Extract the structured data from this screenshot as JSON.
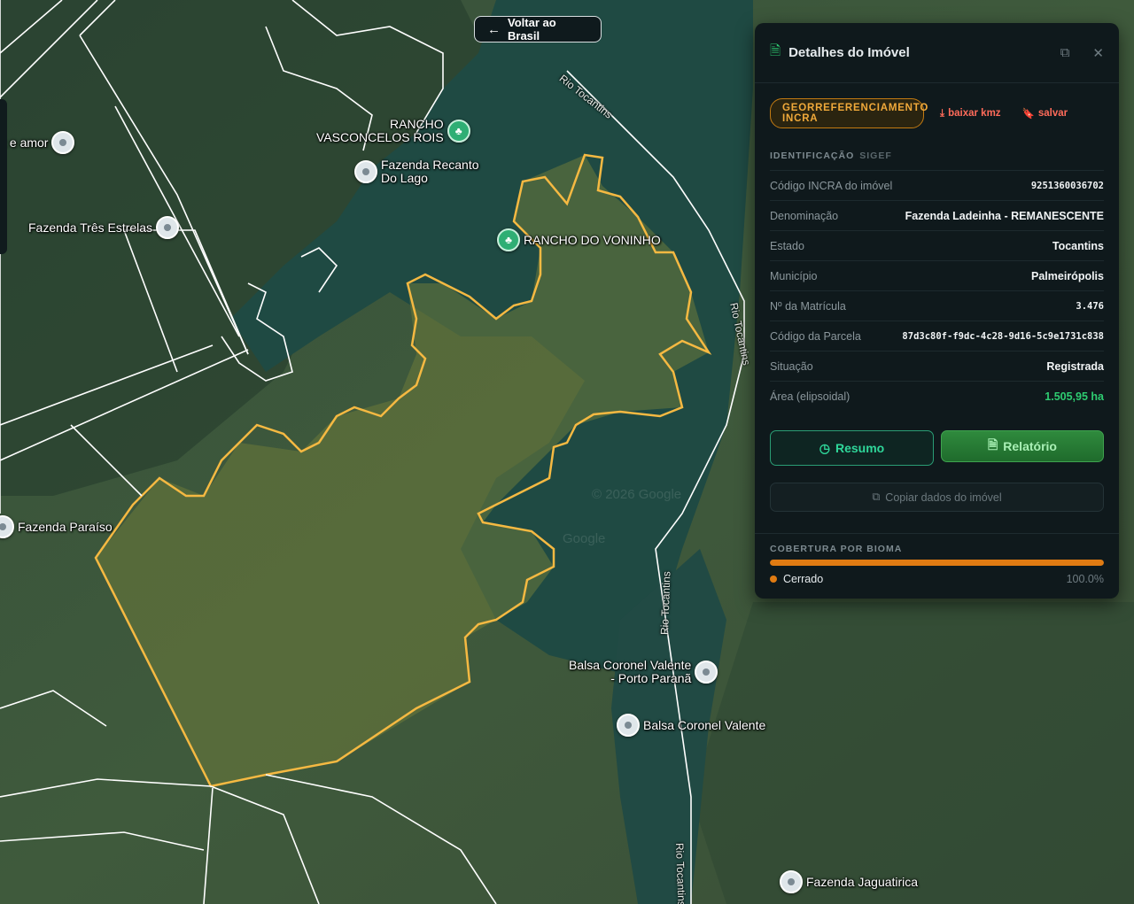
{
  "back_button": {
    "label": "Voltar ao Brasil",
    "icon": "arrow-left-icon"
  },
  "map": {
    "pois": [
      {
        "label": "z e amor",
        "type": "pin"
      },
      {
        "label_line1": "RANCHO",
        "label_line2": "VASCONCELOS ROIS",
        "type": "park"
      },
      {
        "label_line1": "Fazenda Recanto",
        "label_line2": "Do Lago",
        "type": "pin"
      },
      {
        "label": "Fazenda Três Estrelas",
        "type": "pin"
      },
      {
        "label": "RANCHO DO VONINHO",
        "type": "park"
      },
      {
        "label": "Fazenda Paraíso",
        "type": "pin"
      },
      {
        "label_line1": "Balsa Coronel Valente",
        "label_line2": "- Porto Paranã",
        "type": "pin"
      },
      {
        "label": "Balsa Coronel Valente",
        "type": "pin"
      },
      {
        "label": "Fazenda Jaguatirica",
        "type": "pin"
      }
    ],
    "rivers": [
      "Rio Tocantins",
      "Rio Tocantins",
      "Rio Tocantins",
      "Rio Tocantins"
    ],
    "watermarks": [
      "© 2026 Google",
      "Google"
    ],
    "colors": {
      "parcel_outline": "#f5b942",
      "boundary_lines": "#ffffff",
      "water": "#1f4a43"
    }
  },
  "panel": {
    "title": "Detalhes do Imóvel",
    "title_icon": "document-icon",
    "tag": "GEORREFERENCIAMENTO INCRA",
    "download_kmz": "baixar kmz",
    "save": "salvar",
    "identification_label": "IDENTIFICAÇÃO",
    "identification_sub": "SIGEF",
    "rows": [
      {
        "key": "Código INCRA do imóvel",
        "value": "9251360036702"
      },
      {
        "key": "Denominação",
        "value": "Fazenda Ladeinha - REMANESCENTE"
      },
      {
        "key": "Estado",
        "value": "Tocantins"
      },
      {
        "key": "Município",
        "value": "Palmeirópolis"
      },
      {
        "key": "Nº da Matrícula",
        "value": "3.476"
      },
      {
        "key": "Código da Parcela",
        "value": "87d3c80f-f9dc-4c28-9d16-5c9e1731c838"
      },
      {
        "key": "Situação",
        "value": "Registrada"
      },
      {
        "key": "Área (elipsoidal)",
        "value": "1.505,95 ha"
      }
    ],
    "resumo_button": "Resumo",
    "relatorio_button": "Relatório",
    "copy_button": "Copiar dados do imóvel",
    "bioma_label": "COBERTURA POR BIOMA",
    "bioma": {
      "name": "Cerrado",
      "percent_text": "100.0%",
      "fraction": 1.0,
      "color": "#e07b12"
    }
  }
}
